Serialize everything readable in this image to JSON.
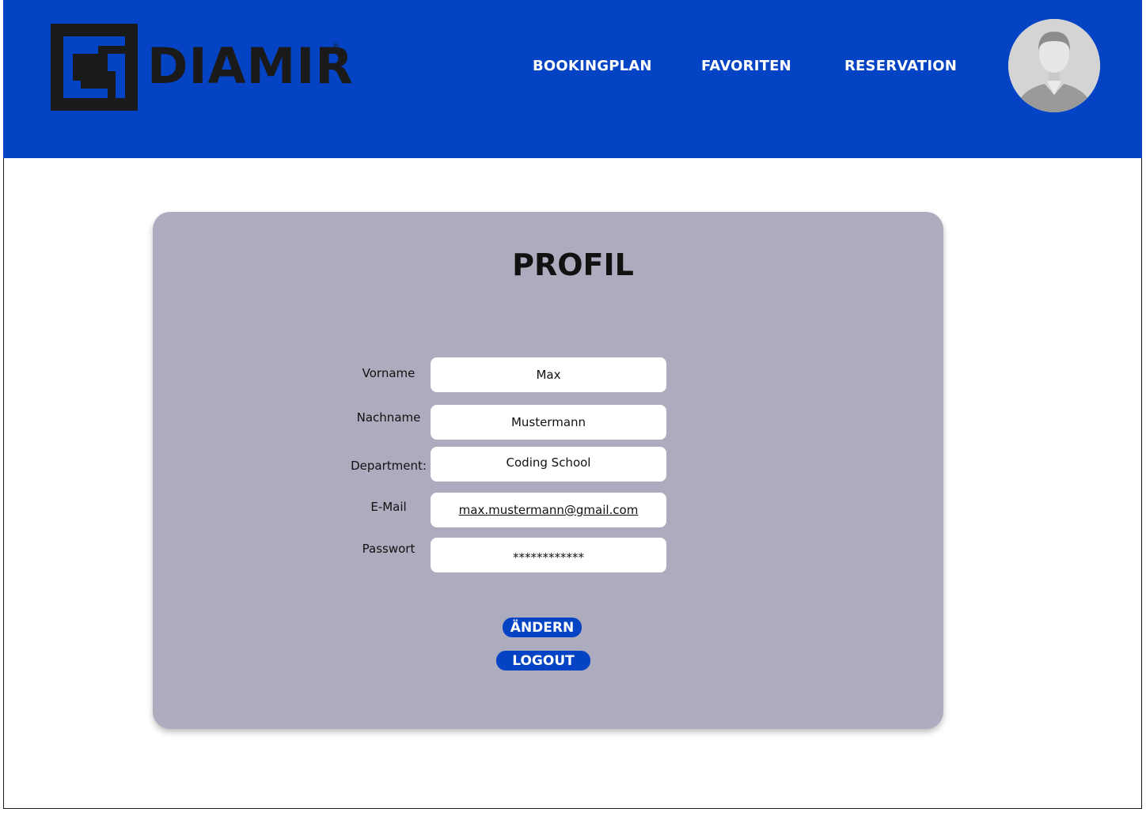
{
  "brand": {
    "name": "DIAMIR",
    "registered": "®"
  },
  "nav": {
    "items": [
      {
        "label": "BOOKINGPLAN"
      },
      {
        "label": "FAVORITEN"
      },
      {
        "label": "RESERVATION"
      }
    ]
  },
  "profile": {
    "title": "PROFIL",
    "fields": [
      {
        "label": "Vorname",
        "value": "Max"
      },
      {
        "label": "Nachname",
        "value": "Mustermann"
      },
      {
        "label": "Department:",
        "value": "Coding School"
      },
      {
        "label": "E-Mail",
        "value": "max.mustermann@gmail.com"
      },
      {
        "label": "Passwort",
        "value": "************"
      }
    ],
    "buttons": {
      "change": "ÄNDERN",
      "logout": "LOGOUT"
    }
  },
  "colors": {
    "header_bg": "#0444c4",
    "card_bg": "#adabbe",
    "button_bg": "#0444c4",
    "logo": "#1a1a1a"
  }
}
